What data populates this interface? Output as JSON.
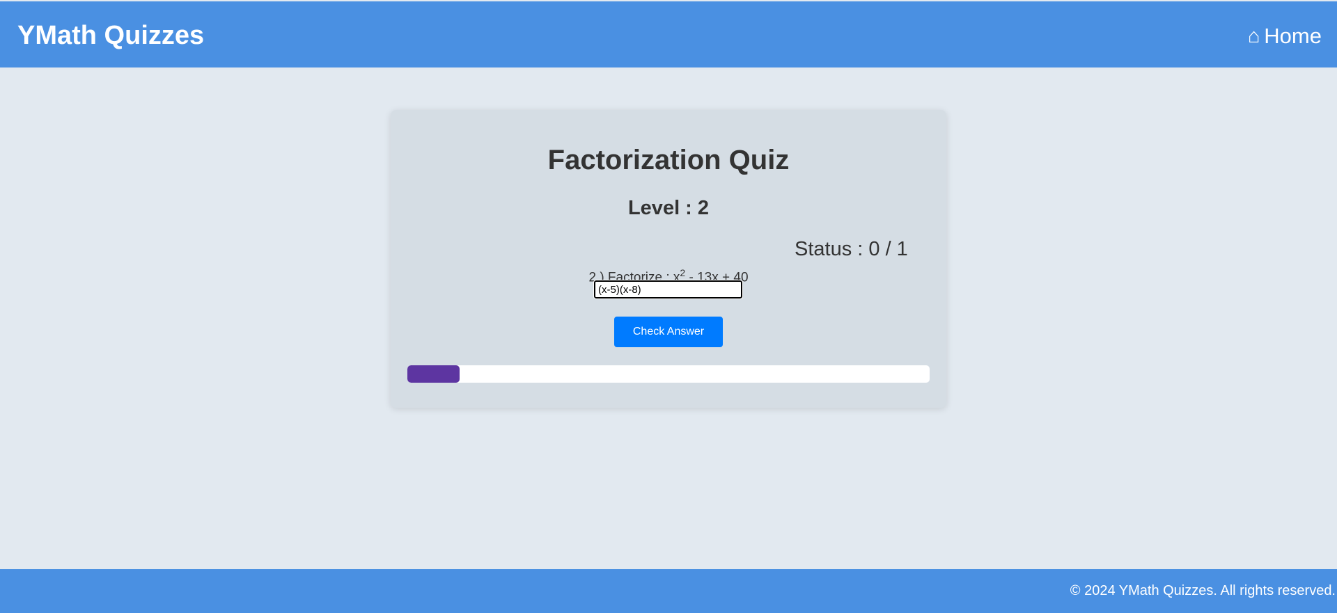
{
  "header": {
    "brand": "YMath Quizzes",
    "home_icon": "⌂",
    "home_label": "Home"
  },
  "quiz": {
    "title": "Factorization Quiz",
    "level": "Level : 2",
    "status": "Status : 0 / 1",
    "question_prefix": "2 ) Factorize : x",
    "question_exponent": "2",
    "question_suffix": " - 13x + 40",
    "answer_value": "(x-5)(x-8)",
    "check_button": "Check Answer",
    "progress_fraction": 0.1
  },
  "footer": {
    "copyright": "© 2024 YMath Quizzes. All rights reserved."
  },
  "colors": {
    "header_bg": "#4a90e2",
    "page_bg": "#e2e9f0",
    "card_bg": "#d5dde4",
    "button_bg": "#007bff",
    "progress_fill": "#5d35a1"
  }
}
